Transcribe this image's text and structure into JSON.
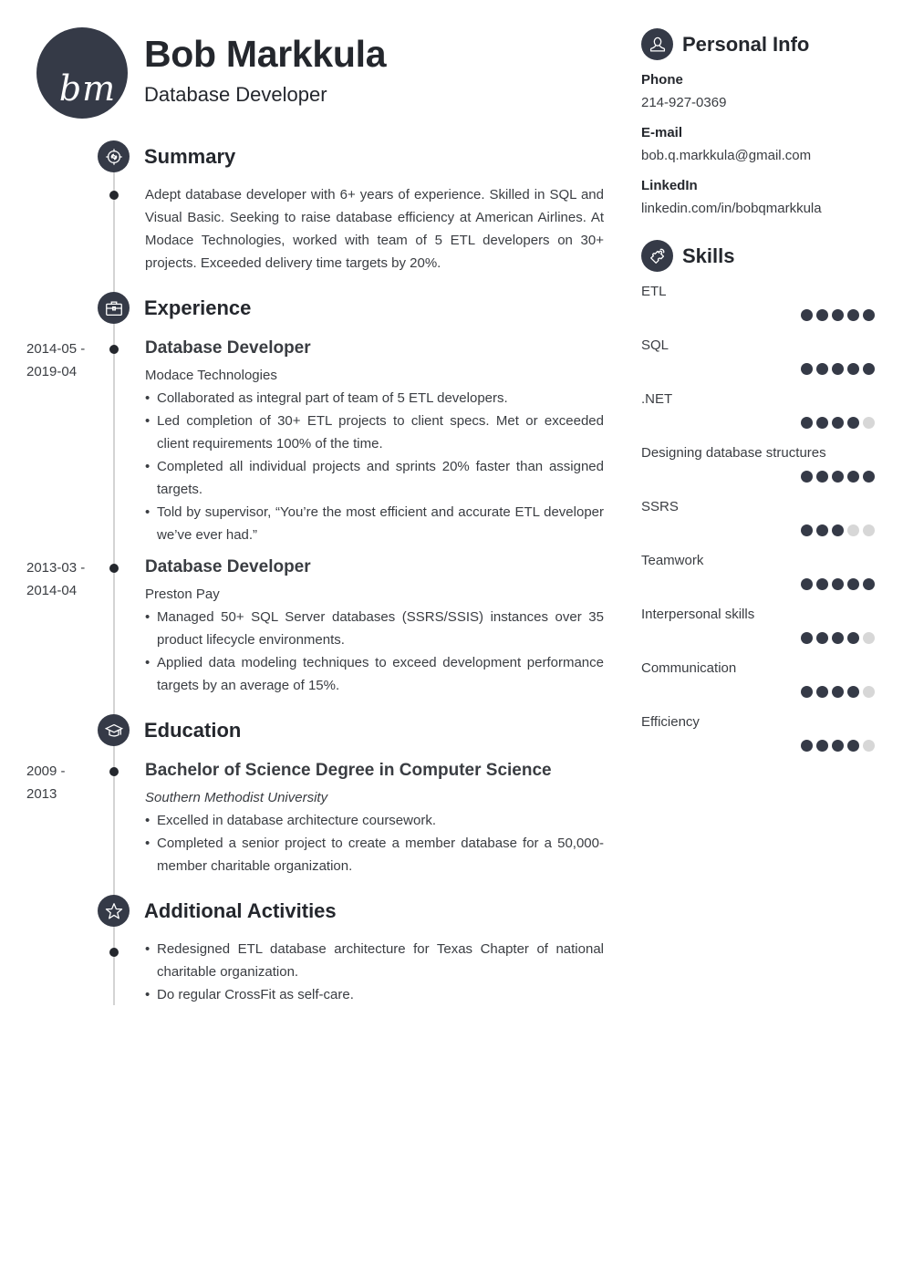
{
  "header": {
    "monogram": "bm",
    "name": "Bob Markkula",
    "title": "Database Developer"
  },
  "sections": {
    "summary": {
      "title": "Summary",
      "icon": "target-icon",
      "text": "Adept database developer with 6+ years of experience. Skilled in SQL and Visual Basic. Seeking to raise database efficiency at American Airlines. At Modace Technologies, worked with team of 5 ETL developers on 30+ projects. Exceeded delivery time targets by 20%."
    },
    "experience": {
      "title": "Experience",
      "icon": "briefcase-icon",
      "entries": [
        {
          "date_start": "2014-05 -",
          "date_end": "2019-04",
          "title": "Database Developer",
          "org": "Modace Technologies",
          "bullets": [
            "Collaborated as integral part of team of 5 ETL developers.",
            "Led completion of 30+ ETL projects to client specs. Met or exceeded client requirements 100% of the time.",
            "Completed all individual projects and sprints 20% faster than assigned targets.",
            "Told by supervisor, “You’re the most efficient and accurate ETL developer we’ve ever had.”"
          ]
        },
        {
          "date_start": "2013-03 -",
          "date_end": "2014-04",
          "title": "Database Developer",
          "org": "Preston Pay",
          "bullets": [
            "Managed 50+ SQL Server databases (SSRS/SSIS) instances over 35 product lifecycle environments.",
            "Applied data modeling techniques to exceed development performance targets by an average of 15%."
          ]
        }
      ]
    },
    "education": {
      "title": "Education",
      "icon": "graduation-cap-icon",
      "entries": [
        {
          "date_start": "2009 -",
          "date_end": "2013",
          "title": "Bachelor of Science Degree in Computer Science",
          "org": "Southern Methodist University",
          "bullets": [
            "Excelled in database architecture coursework.",
            "Completed a senior project to create a member database for a 50,000-member charitable organization."
          ]
        }
      ]
    },
    "activities": {
      "title": "Additional Activities",
      "icon": "star-icon",
      "bullets": [
        "Redesigned ETL database architecture for Texas Chapter of national charitable organization.",
        "Do regular CrossFit as self-care."
      ]
    }
  },
  "personal_info": {
    "title": "Personal Info",
    "icon": "user-icon",
    "fields": [
      {
        "label": "Phone",
        "value": "214-927-0369"
      },
      {
        "label": "E-mail",
        "value": "bob.q.markkula@gmail.com"
      },
      {
        "label": "LinkedIn",
        "value": "linkedin.com/in/bobqmarkkula"
      }
    ]
  },
  "skills": {
    "title": "Skills",
    "icon": "puzzle-icon",
    "max_level": 5,
    "items": [
      {
        "name": "ETL",
        "level": 5
      },
      {
        "name": "SQL",
        "level": 5
      },
      {
        "name": ".NET",
        "level": 4
      },
      {
        "name": "Designing database structures",
        "level": 5
      },
      {
        "name": "SSRS",
        "level": 3
      },
      {
        "name": "Teamwork",
        "level": 5
      },
      {
        "name": "Interpersonal skills",
        "level": 4
      },
      {
        "name": "Communication",
        "level": 4
      },
      {
        "name": "Efficiency",
        "level": 4
      }
    ]
  },
  "colors": {
    "accent": "#353a47",
    "inactive_dot": "#d7d7d7",
    "timeline": "#d4d4d4",
    "heading_text": "#24272d",
    "body_text": "#3a3d42"
  }
}
